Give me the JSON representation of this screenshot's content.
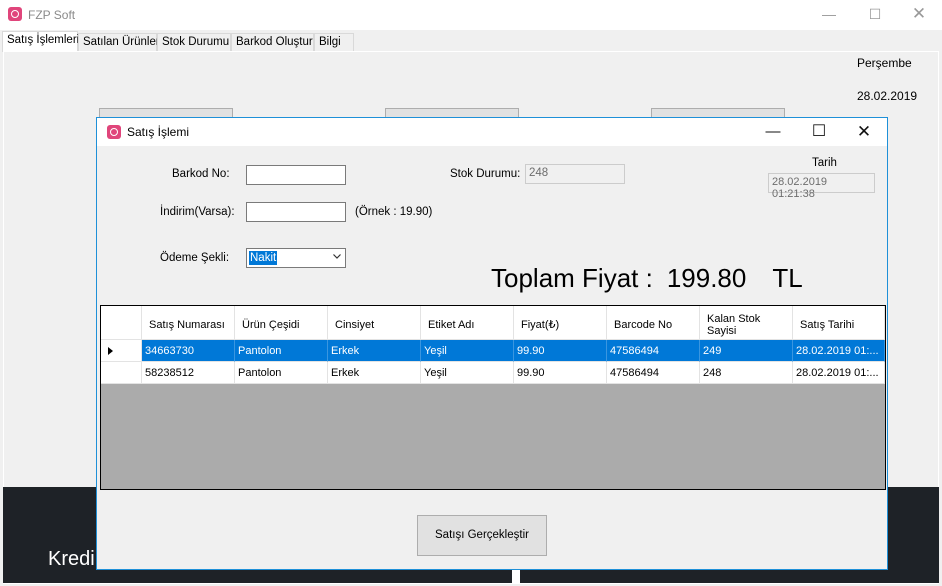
{
  "app": {
    "title": "FZP Soft",
    "logo_icon": "app-logo-icon"
  },
  "tabs": [
    {
      "label": "Satış İşlemleri"
    },
    {
      "label": "Satılan Ürünler"
    },
    {
      "label": "Stok Durumu"
    },
    {
      "label": "Barkod Oluştur"
    },
    {
      "label": "Bilgi"
    }
  ],
  "main": {
    "day": "Perşembe",
    "date": "28.02.2019",
    "panel_text": "Kredi"
  },
  "dialog": {
    "title": "Satış İşlemi",
    "barcode_label": "Barkod No:",
    "barcode_value": "",
    "discount_label": "İndirim(Varsa):",
    "discount_value": "",
    "discount_hint": "(Örnek : 19.90)",
    "stock_label": "Stok Durumu:",
    "stock_value": "248",
    "payment_label": "Ödeme Şekli:",
    "payment_value": "Nakit",
    "date_label": "Tarih",
    "date_value": "28.02.2019 01:21:38",
    "total_label": "Toplam Fiyat :",
    "total_value": "199.80",
    "total_currency": "TL",
    "submit_label": "Satışı Gerçekleştir"
  },
  "grid": {
    "columns": [
      "Satış Numarası",
      "Ürün Çeşidi",
      "Cinsiyet",
      "Etiket Adı",
      "Fiyat(₺)",
      "Barcode No",
      "Kalan Stok Sayisi",
      "Satış Tarihi"
    ],
    "rows": [
      [
        "34663730",
        "Pantolon",
        "Erkek",
        "Yeşil",
        "99.90",
        "47586494",
        "249",
        "28.02.2019 01:..."
      ],
      [
        "58238512",
        "Pantolon",
        "Erkek",
        "Yeşil",
        "99.90",
        "47586494",
        "248",
        "28.02.2019 01:..."
      ]
    ],
    "selected_row": 0
  },
  "colors": {
    "accent": "#0078d7",
    "dialog_border": "#1e90d8",
    "logo": "#e0457b",
    "dark_panel": "#1e2227"
  }
}
